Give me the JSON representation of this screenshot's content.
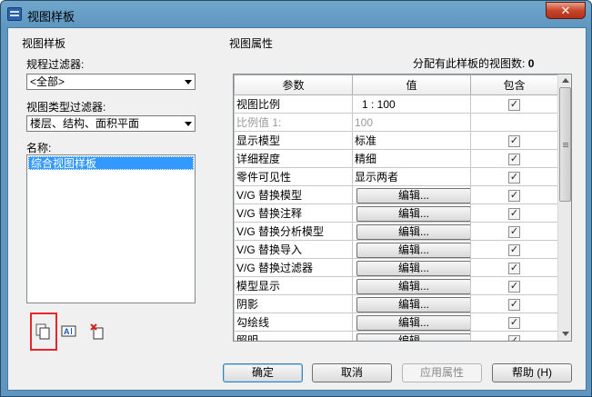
{
  "window": {
    "title": "视图样板",
    "close_glyph": "✕"
  },
  "left_panel": {
    "group_title": "视图样板",
    "discipline_filter": {
      "label": "规程过滤器:",
      "value": "<全部>"
    },
    "view_type_filter": {
      "label": "视图类型过滤器:",
      "value": "楼层、结构、面积平面"
    },
    "names": {
      "label": "名称:",
      "items": [
        "综合视图样板"
      ]
    },
    "tools": [
      {
        "name": "duplicate-icon"
      },
      {
        "name": "rename-icon"
      },
      {
        "name": "delete-icon"
      }
    ]
  },
  "right_panel": {
    "group_title": "视图属性",
    "assigned_count_label": "分配有此样板的视图数:",
    "assigned_count_value": "0",
    "table": {
      "headers": [
        "参数",
        "值",
        "包含"
      ],
      "rows": [
        {
          "param": "视图比例",
          "value": "1 : 100",
          "type": "text",
          "include": true,
          "enabled": true
        },
        {
          "param": "比例值 1:",
          "value": "100",
          "type": "text",
          "include": null,
          "enabled": false
        },
        {
          "param": "显示模型",
          "value": "标准",
          "type": "text",
          "include": true,
          "enabled": true
        },
        {
          "param": "详细程度",
          "value": "精细",
          "type": "text",
          "include": true,
          "enabled": true
        },
        {
          "param": "零件可见性",
          "value": "显示两者",
          "type": "text",
          "include": true,
          "enabled": true
        },
        {
          "param": "V/G 替换模型",
          "value": "编辑...",
          "type": "button",
          "include": true,
          "enabled": true
        },
        {
          "param": "V/G 替换注释",
          "value": "编辑...",
          "type": "button",
          "include": true,
          "enabled": true
        },
        {
          "param": "V/G 替换分析模型",
          "value": "编辑...",
          "type": "button",
          "include": true,
          "enabled": true
        },
        {
          "param": "V/G 替换导入",
          "value": "编辑...",
          "type": "button",
          "include": true,
          "enabled": true
        },
        {
          "param": "V/G 替换过滤器",
          "value": "编辑...",
          "type": "button",
          "include": true,
          "enabled": true
        },
        {
          "param": "模型显示",
          "value": "编辑...",
          "type": "button",
          "include": true,
          "enabled": true
        },
        {
          "param": "阴影",
          "value": "编辑...",
          "type": "button",
          "include": true,
          "enabled": true
        },
        {
          "param": "勾绘线",
          "value": "编辑...",
          "type": "button",
          "include": true,
          "enabled": true
        },
        {
          "param": "照明",
          "value": "编辑...",
          "type": "button",
          "include": true,
          "enabled": true
        }
      ]
    }
  },
  "buttons": {
    "ok": "确定",
    "cancel": "取消",
    "apply": "应用属性",
    "help": "帮助 (H)"
  },
  "colors": {
    "selection": "#3399ff",
    "highlight_box": "#e8262a",
    "title_bar": "#5d96c0"
  }
}
